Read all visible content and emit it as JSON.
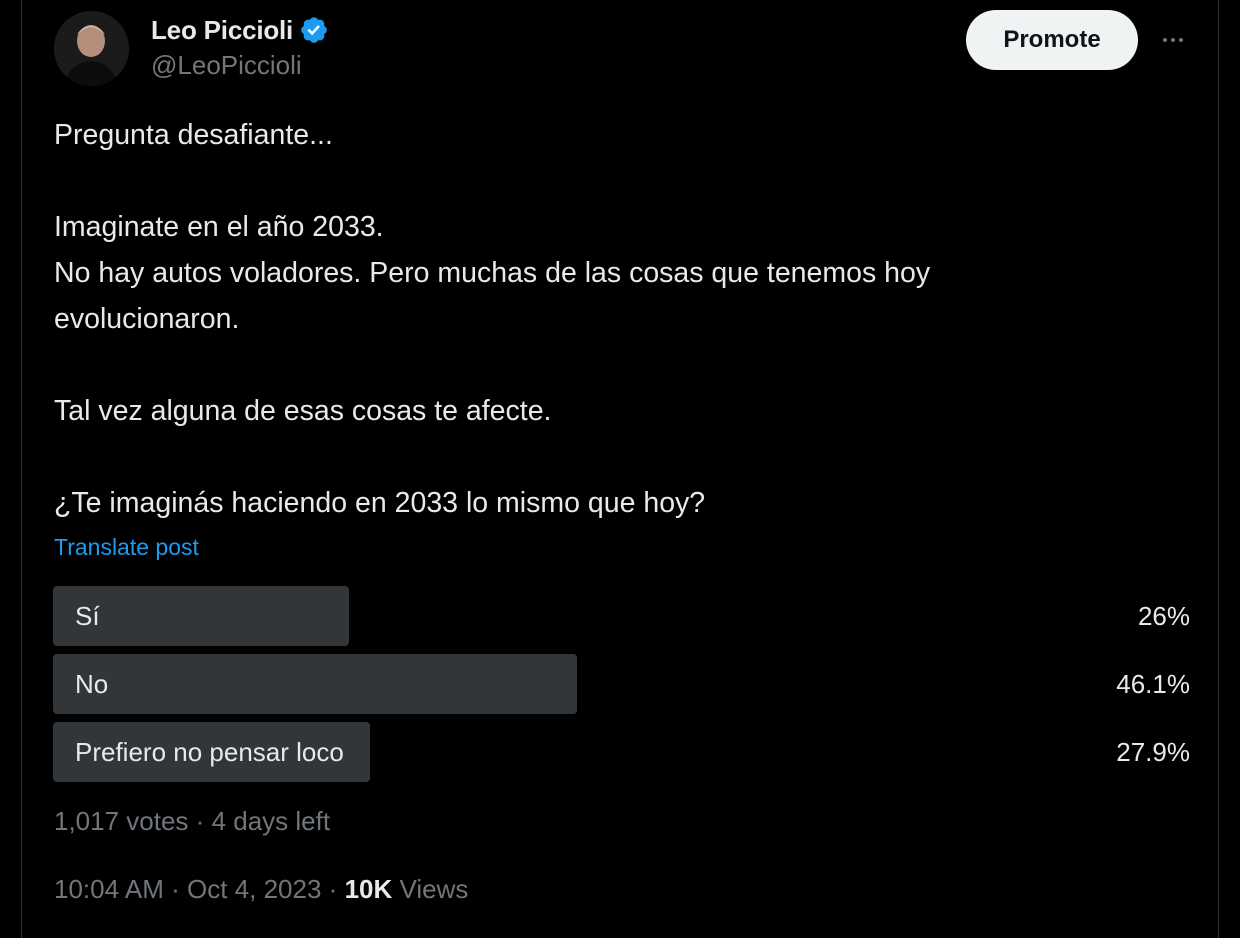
{
  "author": {
    "display_name": "Leo Piccioli",
    "handle": "@LeoPiccioli",
    "verified_icon": "verified-badge-icon"
  },
  "header": {
    "promote_label": "Promote",
    "more_icon": "more-horizontal-icon"
  },
  "post": {
    "lines": [
      "Pregunta desafiante...",
      "Imaginate en el año 2033.",
      "No hay autos voladores. Pero muchas de las cosas que tenemos hoy",
      "evolucionaron.",
      "Tal vez alguna de esas cosas te afecte.",
      "¿Te imaginás haciendo en 2033 lo mismo que hoy?"
    ],
    "translate_label": "Translate post"
  },
  "poll": {
    "options": [
      {
        "label": "Sí",
        "percent_text": "26%",
        "percent": 26
      },
      {
        "label": "No",
        "percent_text": "46.1%",
        "percent": 46.1
      },
      {
        "label": "Prefiero no pensar loco",
        "percent_text": "27.9%",
        "percent": 27.9
      }
    ],
    "votes": "1,017 votes",
    "separator": "·",
    "time_left": "4 days left"
  },
  "meta": {
    "time": "10:04 AM",
    "separator": "·",
    "date": "Oct 4, 2023",
    "views_count": "10K",
    "views_label": "Views"
  },
  "colors": {
    "background": "#000000",
    "text": "#e7e9ea",
    "secondary_text": "#71767b",
    "accent": "#1d9bf0",
    "poll_bar": "#333639",
    "promote_bg": "#eff3f4"
  }
}
